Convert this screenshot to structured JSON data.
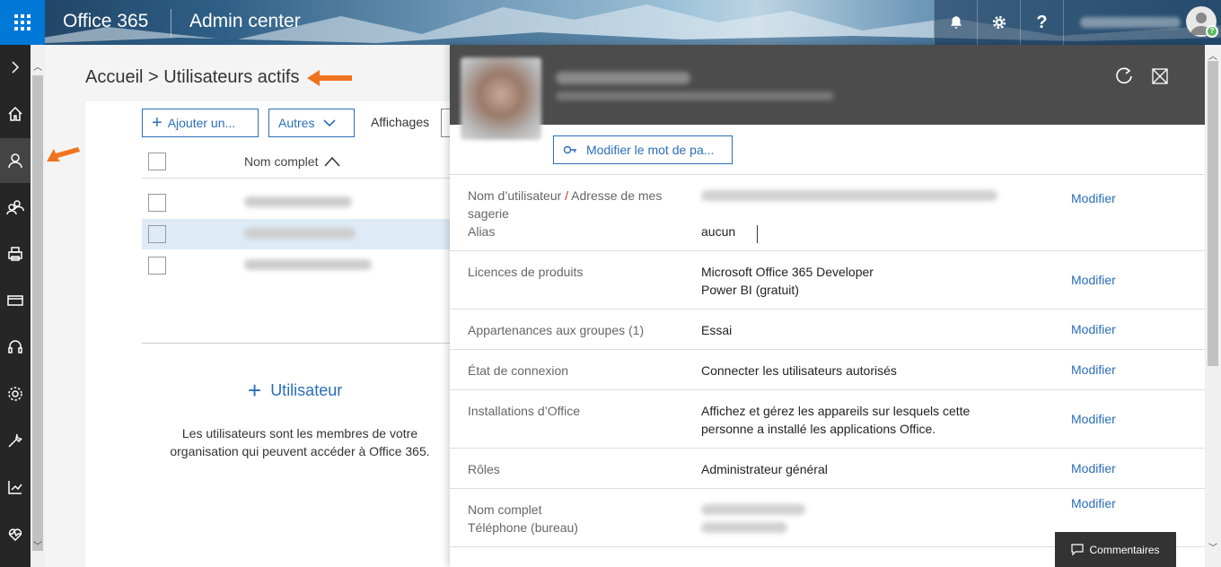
{
  "topbar": {
    "app_name": "Office 365",
    "app_sub": "Admin center",
    "icons": [
      "bell-icon",
      "gear-icon",
      "help-icon"
    ],
    "help_glyph": "?"
  },
  "breadcrumb": {
    "home": "Accueil",
    "separator": ">",
    "current": "Utilisateurs actifs"
  },
  "toolbar": {
    "add_label": "Ajouter un...",
    "more_label": "Autres",
    "views_label": "Affichages"
  },
  "list": {
    "column_header": "Nom complet"
  },
  "empty": {
    "add_user_label": "Utilisateur",
    "description": "Les utilisateurs sont les membres de votre organisation qui peuvent accéder à Office 365."
  },
  "panel": {
    "reset_password_label": "Modifier le mot de pa...",
    "edit_label": "Modifier",
    "sections": {
      "username_label_1": "Nom d’utilisateur",
      "username_slash": "/",
      "username_label_2": "Adresse de mes",
      "username_label_3": "sagerie",
      "alias_label": "Alias",
      "alias_value": "aucun",
      "licenses_label": "Licences de produits",
      "license_1": "Microsoft Office 365 Developer",
      "license_2": "Power BI (gratuit)",
      "groups_label": "Appartenances aux groupes (1)",
      "groups_value": "Essai",
      "signin_label": "État de connexion",
      "signin_value": "Connecter les utilisateurs autorisés",
      "installs_label": "Installations d’Office",
      "installs_value_1": "Affichez et gérez les appareils sur lesquels cette",
      "installs_value_2": "personne a installé les applications Office.",
      "roles_label": "Rôles",
      "roles_value": "Administrateur général",
      "fullname_label": "Nom complet",
      "phone_label": "Téléphone (bureau)"
    }
  },
  "feedback": {
    "label": "Commentaires"
  },
  "colors": {
    "accent": "#2a6ebb",
    "nav_bg": "#262626",
    "waffle_bg": "#0078d7",
    "panel_header": "#4c4c4c",
    "annotation_arrow": "#f07320"
  }
}
